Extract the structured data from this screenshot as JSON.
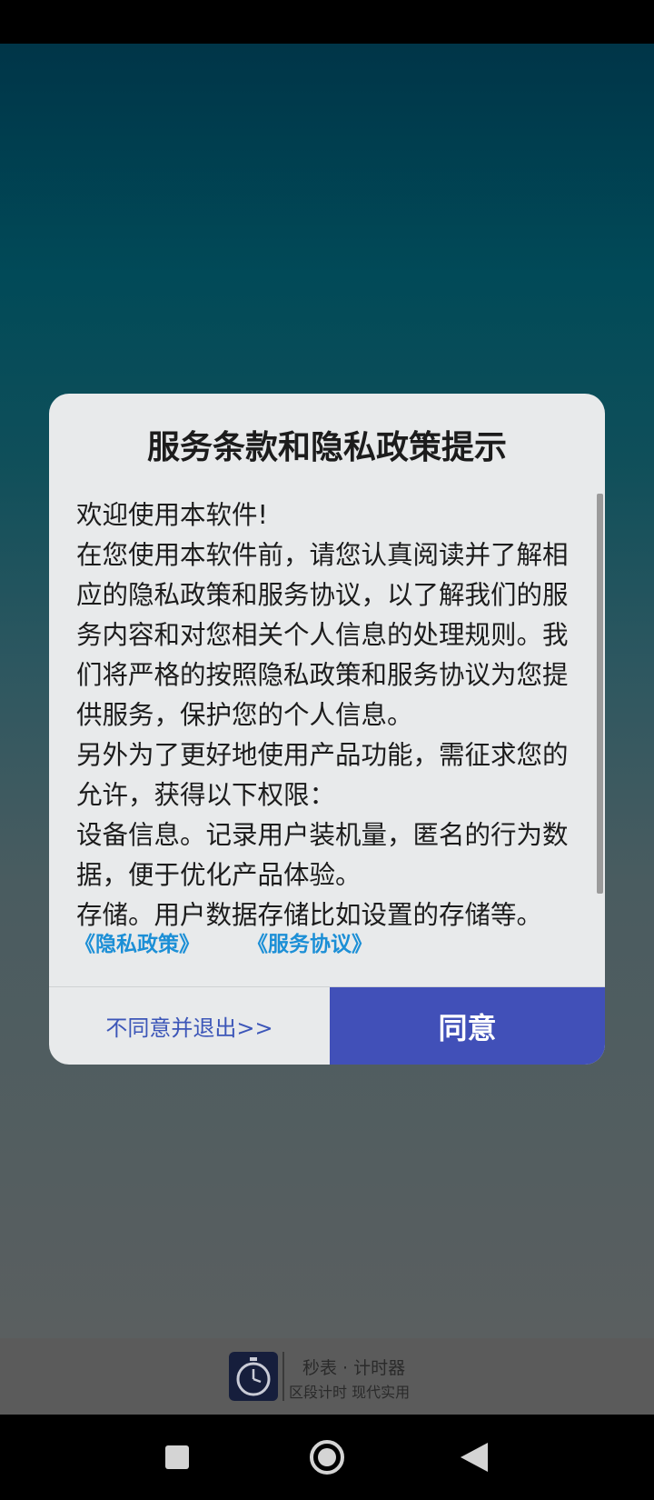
{
  "dialog": {
    "title": "服务条款和隐私政策提示",
    "paragraphs": [
      "欢迎使用本软件!",
      "在您使用本软件前，请您认真阅读并了解相应的隐私政策和服务协议，以了解我们的服务内容和对您相关个人信息的处理规则。我们将严格的按照隐私政策和服务协议为您提供服务，保护您的个人信息。",
      "另外为了更好地使用产品功能，需征求您的允许，获得以下权限：",
      "设备信息。记录用户装机量，匿名的行为数据，便于优化产品体验。",
      "存储。用户数据存储比如设置的存储等。"
    ],
    "privacy_link": "《隐私政策》",
    "terms_link": "《服务协议》",
    "disagree_label": "不同意并退出>>",
    "agree_label": "同意"
  },
  "splash": {
    "app_name": "秒表 · 计时器",
    "tagline": "区段计时  现代实用"
  },
  "nav": {
    "icons": [
      "recent-apps-icon",
      "home-icon",
      "back-icon"
    ]
  },
  "colors": {
    "accent": "#4150b8",
    "link": "#1c8fd6",
    "dialog_bg": "#e8eaeb"
  }
}
